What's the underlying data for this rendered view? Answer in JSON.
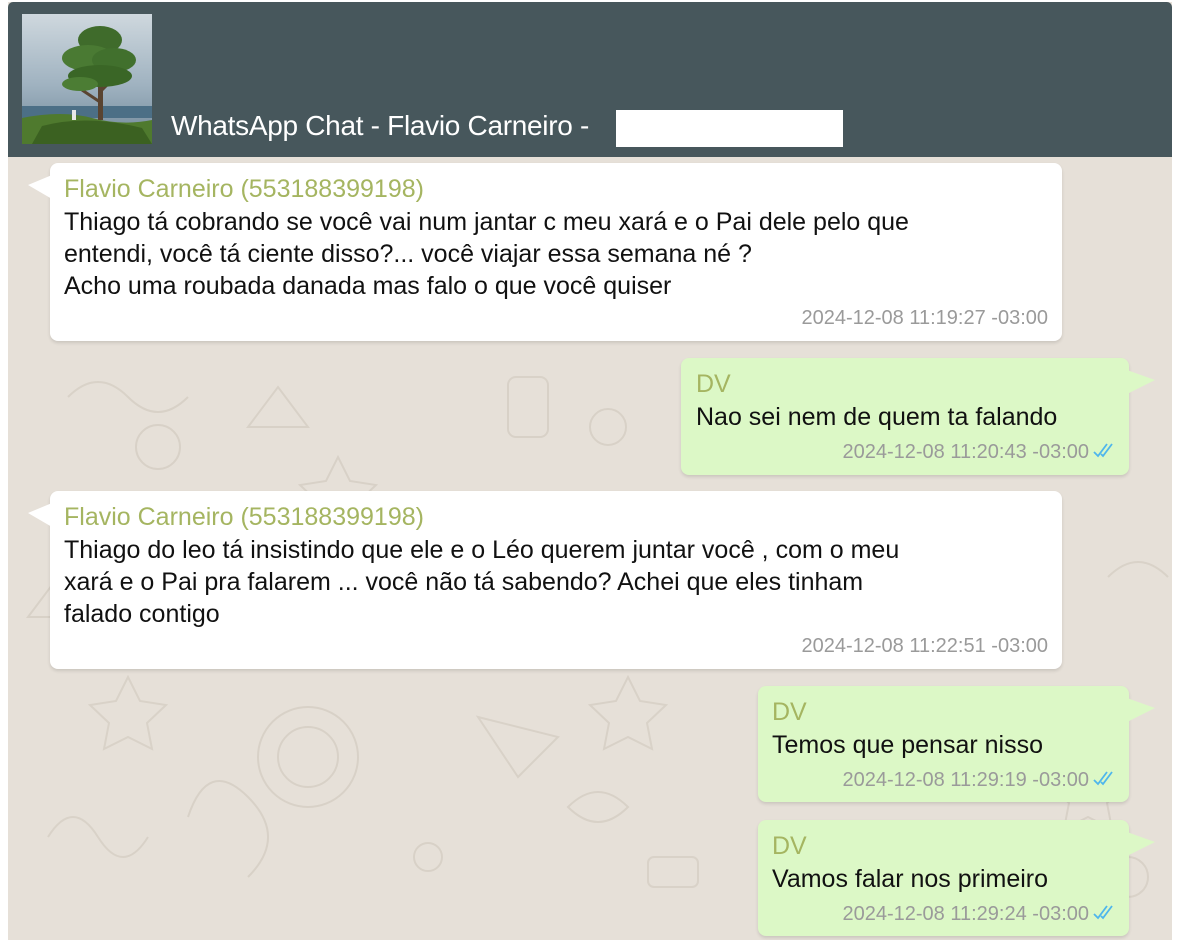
{
  "header": {
    "title": "WhatsApp Chat - Flavio Carneiro -"
  },
  "messages": [
    {
      "direction": "in",
      "sender": "Flavio Carneiro (553188399198)",
      "lines": [
        "Thiago tá cobrando se você vai num jantar c meu xará e o Pai dele pelo que",
        "entendi, você tá ciente disso?... você viajar essa semana né ?",
        "Acho uma roubada danada mas falo o que você quiser"
      ],
      "timestamp": "2024-12-08 11:19:27 -03:00"
    },
    {
      "direction": "out",
      "sender": "DV",
      "text": "Nao sei nem de quem ta falando",
      "timestamp": "2024-12-08 11:20:43 -03:00",
      "read": true
    },
    {
      "direction": "in",
      "sender": "Flavio Carneiro (553188399198)",
      "lines": [
        "Thiago do leo tá insistindo que ele e o Léo querem juntar você , com o meu",
        "xará e o Pai pra falarem ... você não tá sabendo? Achei que eles tinham",
        "falado contigo"
      ],
      "timestamp": "2024-12-08 11:22:51 -03:00"
    },
    {
      "direction": "out",
      "sender": "DV",
      "text": "Temos que pensar nisso",
      "timestamp": "2024-12-08 11:29:19 -03:00",
      "read": true
    },
    {
      "direction": "out",
      "sender": "DV",
      "text": "Vamos falar nos primeiro",
      "timestamp": "2024-12-08 11:29:24 -03:00",
      "read": true
    }
  ],
  "colors": {
    "header": "#47575c",
    "chat_background": "#e6e0d8",
    "incoming_bubble": "#ffffff",
    "outgoing_bubble": "#dcf8c6",
    "sender_name": "#a5b561",
    "timestamp": "#9a9a9a",
    "read_checks": "#4fb6ec"
  },
  "icons": {
    "read_receipt": "double-check-icon",
    "avatar": "contact-avatar-tree-photo"
  }
}
